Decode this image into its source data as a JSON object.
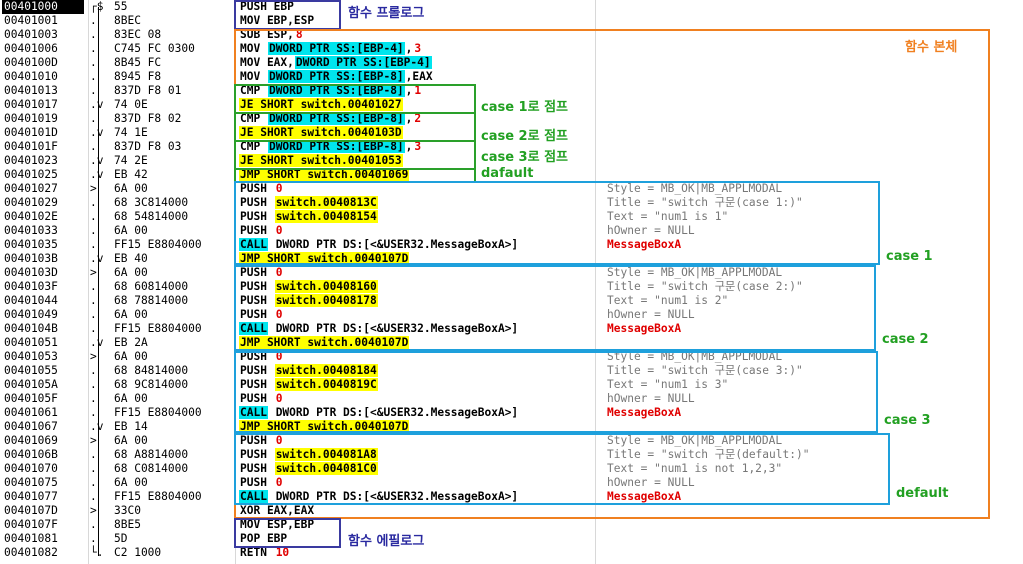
{
  "rows": [
    {
      "addr": "00401000",
      "marker": "┌$",
      "hex": "55",
      "asm": [
        [
          "PUSH EBP",
          ""
        ]
      ],
      "cmt": ""
    },
    {
      "addr": "00401001",
      "marker": ".",
      "hex": "8BEC",
      "asm": [
        [
          "MOV EBP,ESP",
          ""
        ]
      ],
      "cmt": ""
    },
    {
      "addr": "00401003",
      "marker": ".",
      "hex": "83EC 08",
      "asm": [
        [
          "SUB ESP,",
          ""
        ],
        [
          "8",
          "hl-red"
        ]
      ],
      "cmt": ""
    },
    {
      "addr": "00401006",
      "marker": ".",
      "hex": "C745 FC 0300",
      "asm": [
        [
          "MOV ",
          ""
        ],
        [
          "DWORD PTR SS:[EBP-4]",
          "hl-cyan"
        ],
        [
          ",",
          ""
        ],
        [
          "3",
          "hl-red"
        ]
      ],
      "cmt": ""
    },
    {
      "addr": "0040100D",
      "marker": ".",
      "hex": "8B45 FC",
      "asm": [
        [
          "MOV EAX,",
          ""
        ],
        [
          "DWORD PTR SS:[EBP-4]",
          "hl-cyan"
        ]
      ],
      "cmt": ""
    },
    {
      "addr": "00401010",
      "marker": ".",
      "hex": "8945 F8",
      "asm": [
        [
          "MOV ",
          ""
        ],
        [
          "DWORD PTR SS:[EBP-8]",
          "hl-cyan"
        ],
        [
          ",EAX",
          ""
        ]
      ],
      "cmt": ""
    },
    {
      "addr": "00401013",
      "marker": ".",
      "hex": "837D F8 01",
      "asm": [
        [
          "CMP ",
          ""
        ],
        [
          "DWORD PTR SS:[EBP-8]",
          "hl-cyan"
        ],
        [
          ",",
          ""
        ],
        [
          "1",
          "hl-red"
        ]
      ],
      "cmt": ""
    },
    {
      "addr": "00401017",
      "marker": ".v",
      "hex": "74 0E",
      "asm": [
        [
          "JE SHORT switch.00401027",
          "hl-yel"
        ]
      ],
      "cmt": ""
    },
    {
      "addr": "00401019",
      "marker": ".",
      "hex": "837D F8 02",
      "asm": [
        [
          "CMP ",
          ""
        ],
        [
          "DWORD PTR SS:[EBP-8]",
          "hl-cyan"
        ],
        [
          ",",
          ""
        ],
        [
          "2",
          "hl-red"
        ]
      ],
      "cmt": ""
    },
    {
      "addr": "0040101D",
      "marker": ".v",
      "hex": "74 1E",
      "asm": [
        [
          "JE SHORT switch.0040103D",
          "hl-yel"
        ]
      ],
      "cmt": ""
    },
    {
      "addr": "0040101F",
      "marker": ".",
      "hex": "837D F8 03",
      "asm": [
        [
          "CMP ",
          ""
        ],
        [
          "DWORD PTR SS:[EBP-8]",
          "hl-cyan"
        ],
        [
          ",",
          ""
        ],
        [
          "3",
          "hl-red"
        ]
      ],
      "cmt": ""
    },
    {
      "addr": "00401023",
      "marker": ".v",
      "hex": "74 2E",
      "asm": [
        [
          "JE SHORT switch.00401053",
          "hl-yel"
        ]
      ],
      "cmt": ""
    },
    {
      "addr": "00401025",
      "marker": ".v",
      "hex": "EB 42",
      "asm": [
        [
          "JMP SHORT switch.00401069",
          "hl-yel"
        ]
      ],
      "cmt": ""
    },
    {
      "addr": "00401027",
      "marker": ">",
      "hex": "6A 00",
      "asm": [
        [
          "PUSH ",
          ""
        ],
        [
          "0",
          "hl-red"
        ]
      ],
      "cmt": "Style = MB_OK|MB_APPLMODAL"
    },
    {
      "addr": "00401029",
      "marker": ".",
      "hex": "68 3C814000",
      "asm": [
        [
          "PUSH ",
          ""
        ],
        [
          "switch.0040813C",
          "hl-yel"
        ]
      ],
      "cmt": "Title = \"switch 구문(case 1:)\""
    },
    {
      "addr": "0040102E",
      "marker": ".",
      "hex": "68 54814000",
      "asm": [
        [
          "PUSH ",
          ""
        ],
        [
          "switch.00408154",
          "hl-yel"
        ]
      ],
      "cmt": "Text = \"num1 is 1\""
    },
    {
      "addr": "00401033",
      "marker": ".",
      "hex": "6A 00",
      "asm": [
        [
          "PUSH ",
          ""
        ],
        [
          "0",
          "hl-red"
        ]
      ],
      "cmt": "hOwner = NULL"
    },
    {
      "addr": "00401035",
      "marker": ".",
      "hex": "FF15 E8804000",
      "asm": [
        [
          "CALL",
          "hl-cyan"
        ],
        [
          " DWORD PTR DS:[<&USER32.MessageBoxA>]",
          ""
        ]
      ],
      "cmt": "MessageBoxA",
      "cmtRed": true
    },
    {
      "addr": "0040103B",
      "marker": ".v",
      "hex": "EB 40",
      "asm": [
        [
          "JMP SHORT switch.0040107D",
          "hl-yel"
        ]
      ],
      "cmt": ""
    },
    {
      "addr": "0040103D",
      "marker": ">",
      "hex": "6A 00",
      "asm": [
        [
          "PUSH ",
          ""
        ],
        [
          "0",
          "hl-red"
        ]
      ],
      "cmt": "Style = MB_OK|MB_APPLMODAL"
    },
    {
      "addr": "0040103F",
      "marker": ".",
      "hex": "68 60814000",
      "asm": [
        [
          "PUSH ",
          ""
        ],
        [
          "switch.00408160",
          "hl-yel"
        ]
      ],
      "cmt": "Title = \"switch 구문(case 2:)\""
    },
    {
      "addr": "00401044",
      "marker": ".",
      "hex": "68 78814000",
      "asm": [
        [
          "PUSH ",
          ""
        ],
        [
          "switch.00408178",
          "hl-yel"
        ]
      ],
      "cmt": "Text = \"num1 is 2\""
    },
    {
      "addr": "00401049",
      "marker": ".",
      "hex": "6A 00",
      "asm": [
        [
          "PUSH ",
          ""
        ],
        [
          "0",
          "hl-red"
        ]
      ],
      "cmt": "hOwner = NULL"
    },
    {
      "addr": "0040104B",
      "marker": ".",
      "hex": "FF15 E8804000",
      "asm": [
        [
          "CALL",
          "hl-cyan"
        ],
        [
          " DWORD PTR DS:[<&USER32.MessageBoxA>]",
          ""
        ]
      ],
      "cmt": "MessageBoxA",
      "cmtRed": true
    },
    {
      "addr": "00401051",
      "marker": ".v",
      "hex": "EB 2A",
      "asm": [
        [
          "JMP SHORT switch.0040107D",
          "hl-yel"
        ]
      ],
      "cmt": ""
    },
    {
      "addr": "00401053",
      "marker": ">",
      "hex": "6A 00",
      "asm": [
        [
          "PUSH ",
          ""
        ],
        [
          "0",
          "hl-red"
        ]
      ],
      "cmt": "Style = MB_OK|MB_APPLMODAL"
    },
    {
      "addr": "00401055",
      "marker": ".",
      "hex": "68 84814000",
      "asm": [
        [
          "PUSH ",
          ""
        ],
        [
          "switch.00408184",
          "hl-yel"
        ]
      ],
      "cmt": "Title = \"switch 구문(case 3:)\""
    },
    {
      "addr": "0040105A",
      "marker": ".",
      "hex": "68 9C814000",
      "asm": [
        [
          "PUSH ",
          ""
        ],
        [
          "switch.0040819C",
          "hl-yel"
        ]
      ],
      "cmt": "Text = \"num1 is 3\""
    },
    {
      "addr": "0040105F",
      "marker": ".",
      "hex": "6A 00",
      "asm": [
        [
          "PUSH ",
          ""
        ],
        [
          "0",
          "hl-red"
        ]
      ],
      "cmt": "hOwner = NULL"
    },
    {
      "addr": "00401061",
      "marker": ".",
      "hex": "FF15 E8804000",
      "asm": [
        [
          "CALL",
          "hl-cyan"
        ],
        [
          " DWORD PTR DS:[<&USER32.MessageBoxA>]",
          ""
        ]
      ],
      "cmt": "MessageBoxA",
      "cmtRed": true
    },
    {
      "addr": "00401067",
      "marker": ".v",
      "hex": "EB 14",
      "asm": [
        [
          "JMP SHORT switch.0040107D",
          "hl-yel"
        ]
      ],
      "cmt": ""
    },
    {
      "addr": "00401069",
      "marker": ">",
      "hex": "6A 00",
      "asm": [
        [
          "PUSH ",
          ""
        ],
        [
          "0",
          "hl-red"
        ]
      ],
      "cmt": "Style = MB_OK|MB_APPLMODAL"
    },
    {
      "addr": "0040106B",
      "marker": ".",
      "hex": "68 A8814000",
      "asm": [
        [
          "PUSH ",
          ""
        ],
        [
          "switch.004081A8",
          "hl-yel"
        ]
      ],
      "cmt": "Title = \"switch 구문(default:)\""
    },
    {
      "addr": "00401070",
      "marker": ".",
      "hex": "68 C0814000",
      "asm": [
        [
          "PUSH ",
          ""
        ],
        [
          "switch.004081C0",
          "hl-yel"
        ]
      ],
      "cmt": "Text = \"num1 is not 1,2,3\""
    },
    {
      "addr": "00401075",
      "marker": ".",
      "hex": "6A 00",
      "asm": [
        [
          "PUSH ",
          ""
        ],
        [
          "0",
          "hl-red"
        ]
      ],
      "cmt": "hOwner = NULL"
    },
    {
      "addr": "00401077",
      "marker": ".",
      "hex": "FF15 E8804000",
      "asm": [
        [
          "CALL",
          "hl-cyan"
        ],
        [
          " DWORD PTR DS:[<&USER32.MessageBoxA>]",
          ""
        ]
      ],
      "cmt": "MessageBoxA",
      "cmtRed": true
    },
    {
      "addr": "0040107D",
      "marker": ">",
      "hex": "33C0",
      "asm": [
        [
          "XOR EAX,EAX",
          ""
        ]
      ],
      "cmt": ""
    },
    {
      "addr": "0040107F",
      "marker": ".",
      "hex": "8BE5",
      "asm": [
        [
          "MOV ESP,EBP",
          ""
        ]
      ],
      "cmt": ""
    },
    {
      "addr": "00401081",
      "marker": ".",
      "hex": "5D",
      "asm": [
        [
          "POP EBP",
          ""
        ]
      ],
      "cmt": ""
    },
    {
      "addr": "00401082",
      "marker": "└.",
      "hex": "C2 1000",
      "asm": [
        [
          "RETN ",
          ""
        ],
        [
          "10",
          "hl-red"
        ]
      ],
      "cmt": ""
    }
  ],
  "annotations": {
    "prologue": "함수 프롤로그",
    "body": "함수 본체",
    "jump1": "case 1로 점프",
    "jump2": "case 2로 점프",
    "jump3": "case 3로 점프",
    "jump_default": "dafault",
    "case1": "case 1",
    "case2": "case 2",
    "case3": "case 3",
    "default": "default",
    "epilogue": "함수 에필로그"
  },
  "colors": {
    "prologue_box": "#3a3aa0",
    "body_box": "#f08020",
    "jump_box": "#2aa02a",
    "case_box": "#1ea0dc",
    "prologue_text": "#2a2aa0",
    "body_text": "#f08020",
    "jump_text": "#22a022",
    "case_text": "#22a022"
  }
}
